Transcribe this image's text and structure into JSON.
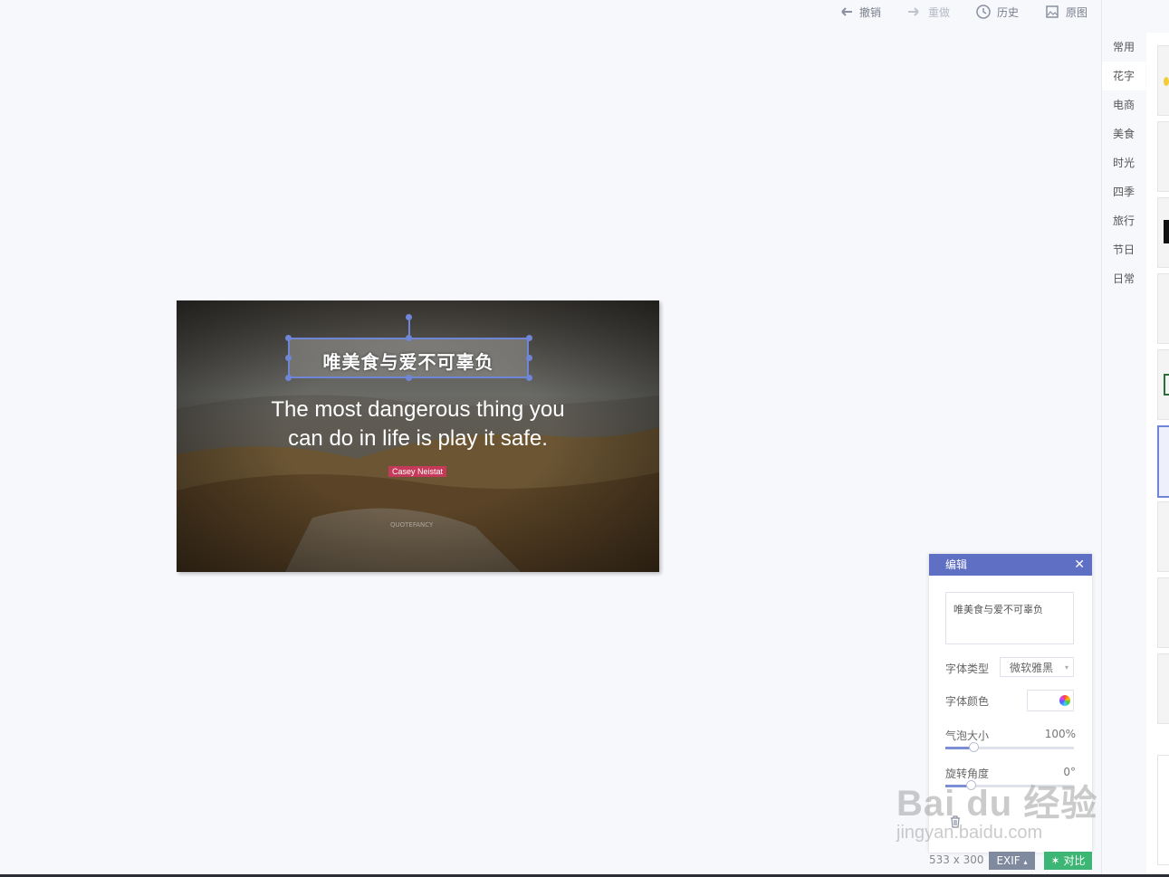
{
  "toolbar": {
    "undo": "撤销",
    "redo": "重做",
    "history": "历史",
    "original": "原图"
  },
  "categories": [
    "常用",
    "花字",
    "电商",
    "美食",
    "时光",
    "四季",
    "旅行",
    "节日",
    "日常"
  ],
  "active_category": "花字",
  "canvas": {
    "quote_line1": "The most dangerous thing you",
    "quote_line2": "can do in life is play it safe.",
    "author": "Casey Neistat",
    "brand": "QUOTEFANCY",
    "sticker_text": "唯美食与爱不可辜负"
  },
  "edit_dialog": {
    "title": "编辑",
    "close_glyph": "✕",
    "text_value": "唯美食与爱不可辜负",
    "font_type_label": "字体类型",
    "font_type_value": "微软雅黑",
    "font_color_label": "字体颜色",
    "bubble_size_label": "气泡大小",
    "bubble_size_value": "100%",
    "bubble_size_level": 0.22,
    "rotation_label": "旋转角度",
    "rotation_value": "0°",
    "rotation_level": 0.0
  },
  "status": {
    "size": "533 x 300",
    "exif": "EXIF",
    "compare": "对比"
  },
  "watermark": {
    "main": "Bai du 经验",
    "sub": "jingyan.baidu.com"
  },
  "colors": {
    "accent": "#6f86d6",
    "dialog_header": "#5e6fc4",
    "compare_green": "#3db574",
    "exif_gray": "#7f8a9f",
    "author_tag": "#c53a5a"
  }
}
